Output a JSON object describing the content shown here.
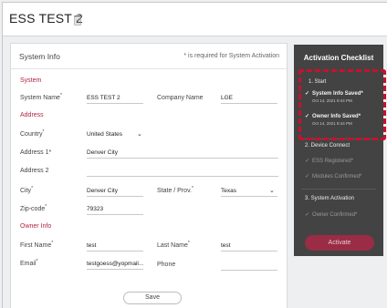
{
  "page": {
    "title": "ESS TEST 2"
  },
  "card": {
    "title": "System Info",
    "required_note": "* is required for System Activation"
  },
  "sections": {
    "system": "System",
    "address": "Address",
    "owner": "Owner Info"
  },
  "labels": {
    "system_name": "System Name",
    "company_name": "Company Name",
    "country": "Country",
    "address1": "Address 1*",
    "address2": "Address 2",
    "city": "City",
    "state": "State / Prov.",
    "zip": "Zip-code",
    "first_name": "First Name",
    "last_name": "Last Name",
    "email": "Email",
    "phone": "Phone"
  },
  "values": {
    "system_name": "ESS TEST 2",
    "company_name": "LGE",
    "country": "United States",
    "address1": "Denver City",
    "address2": "",
    "city": "Denver City",
    "state": "Texas",
    "zip": "79323",
    "first_name": "test",
    "last_name": "test",
    "email": "testgoess@yopmail....",
    "phone": ""
  },
  "save_label": "Save",
  "checklist": {
    "title": "Activation Checklist",
    "groups": [
      {
        "heading": "1. Start",
        "items": [
          {
            "label": "System Info Saved*",
            "date": "Oct 14, 2021 8:44 PM",
            "done": true
          },
          {
            "label": "Owner Info Saved*",
            "date": "Oct 14, 2021 8:44 PM",
            "done": true
          }
        ]
      },
      {
        "heading": "2. Device Connect",
        "items": [
          {
            "label": "ESS Registered*",
            "done": false
          },
          {
            "label": "Modules Confirmed*",
            "done": false
          }
        ]
      },
      {
        "heading": "3. System Activation",
        "items": [
          {
            "label": "Owner Confirmed*",
            "done": false
          }
        ]
      }
    ],
    "activate_label": "Activate"
  },
  "colors": {
    "accent": "#b2233e",
    "panel": "#434343",
    "highlight": "#c8102e",
    "activate": "#9a2c46"
  }
}
